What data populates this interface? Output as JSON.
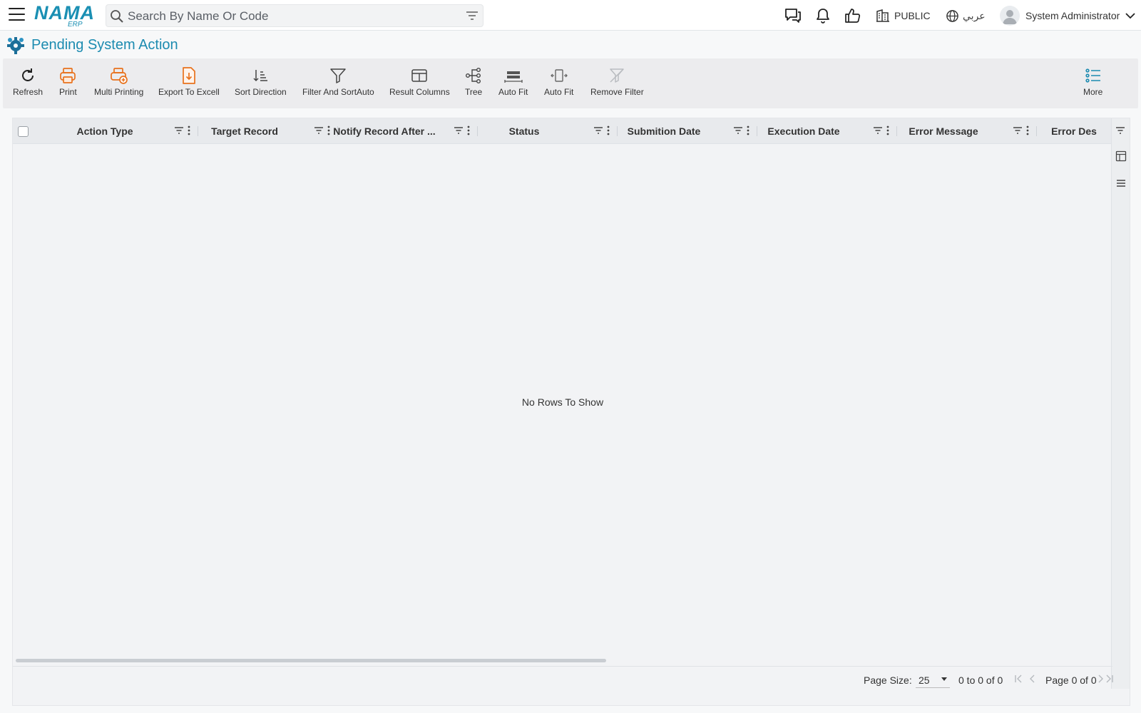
{
  "app": {
    "logo_text": "NAMA",
    "logo_sub": "ERP",
    "brand_color": "#1a8fb3"
  },
  "search": {
    "placeholder": "Search By Name Or Code"
  },
  "topbar": {
    "company": "PUBLIC",
    "language": "عربي",
    "user": "System Administrator"
  },
  "page": {
    "title": "Pending System Action"
  },
  "toolbar": {
    "refresh": "Refresh",
    "print": "Print",
    "multi_printing": "Multi Printing",
    "export_excel": "Export To Excell",
    "sort_direction": "Sort Direction",
    "filter_sort": "Filter And SortAuto",
    "result_columns": "Result Columns",
    "tree": "Tree",
    "auto_fit_1": "Auto Fit",
    "auto_fit_2": "Auto Fit",
    "remove_filter": "Remove Filter",
    "more": "More",
    "accent_color": "#e8711c"
  },
  "grid": {
    "columns": [
      "Action Type",
      "Target Record",
      "Notify Record After ...",
      "Status",
      "Submition Date",
      "Execution Date",
      "Error Message",
      "Error Des"
    ],
    "empty_message": "No Rows To Show",
    "page_size_label": "Page Size:",
    "page_size": "25",
    "range": "0 to 0 of 0",
    "page_info": "Page 0 of 0"
  }
}
